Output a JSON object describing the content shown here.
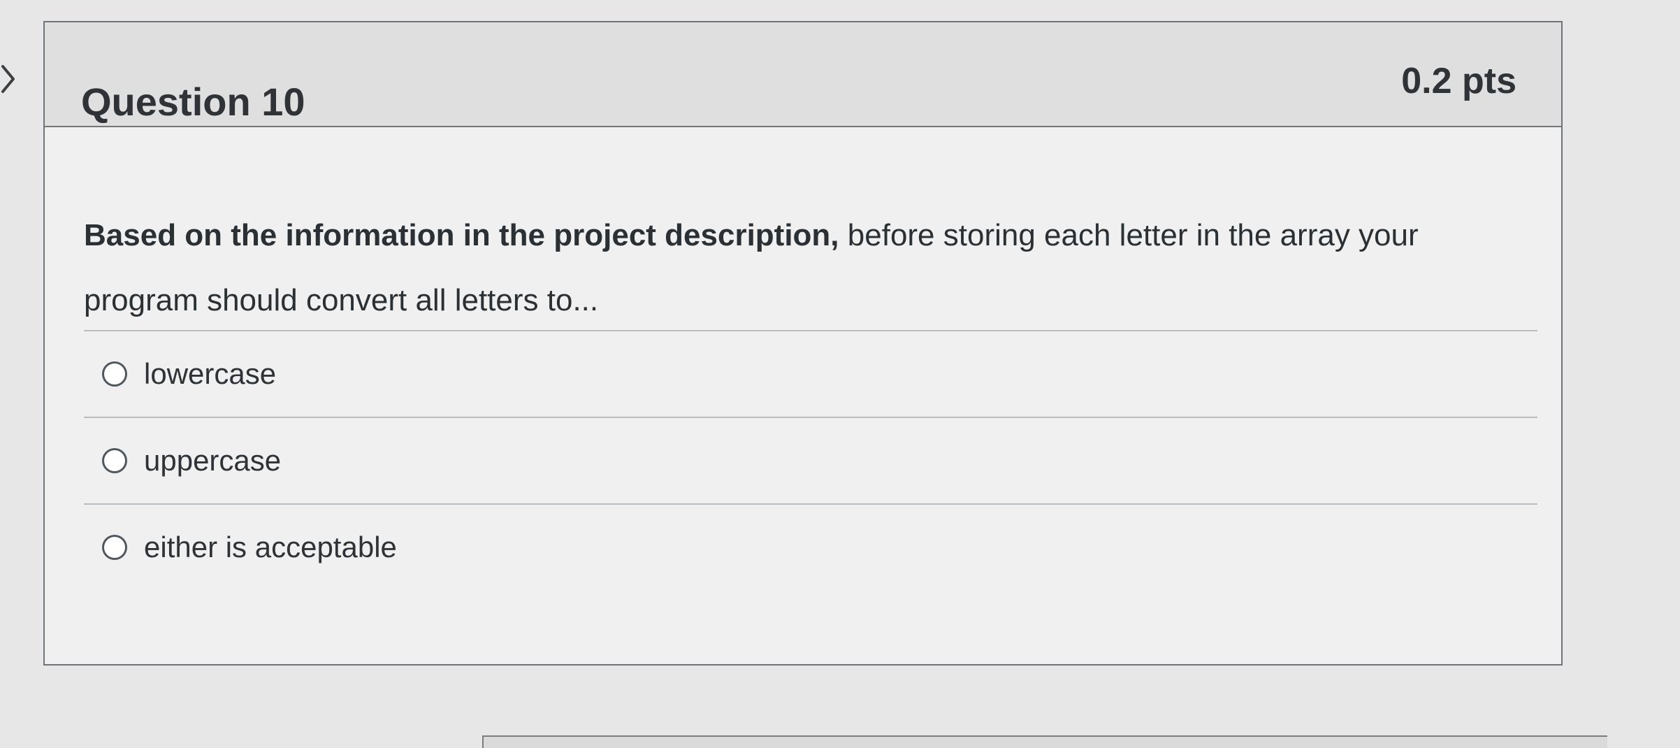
{
  "question": {
    "title": "Question 10",
    "points": "0.2 pts",
    "text_bold": "Based on the information in the project description,",
    "text_rest": " before storing each letter in the array your program should convert all letters to..."
  },
  "answers": [
    {
      "label": "lowercase",
      "selected": false
    },
    {
      "label": "uppercase",
      "selected": false
    },
    {
      "label": "either is acceptable",
      "selected": false
    }
  ],
  "icons": {
    "previous": "chevron-right-icon",
    "answer_control": "radio-button-icon"
  }
}
